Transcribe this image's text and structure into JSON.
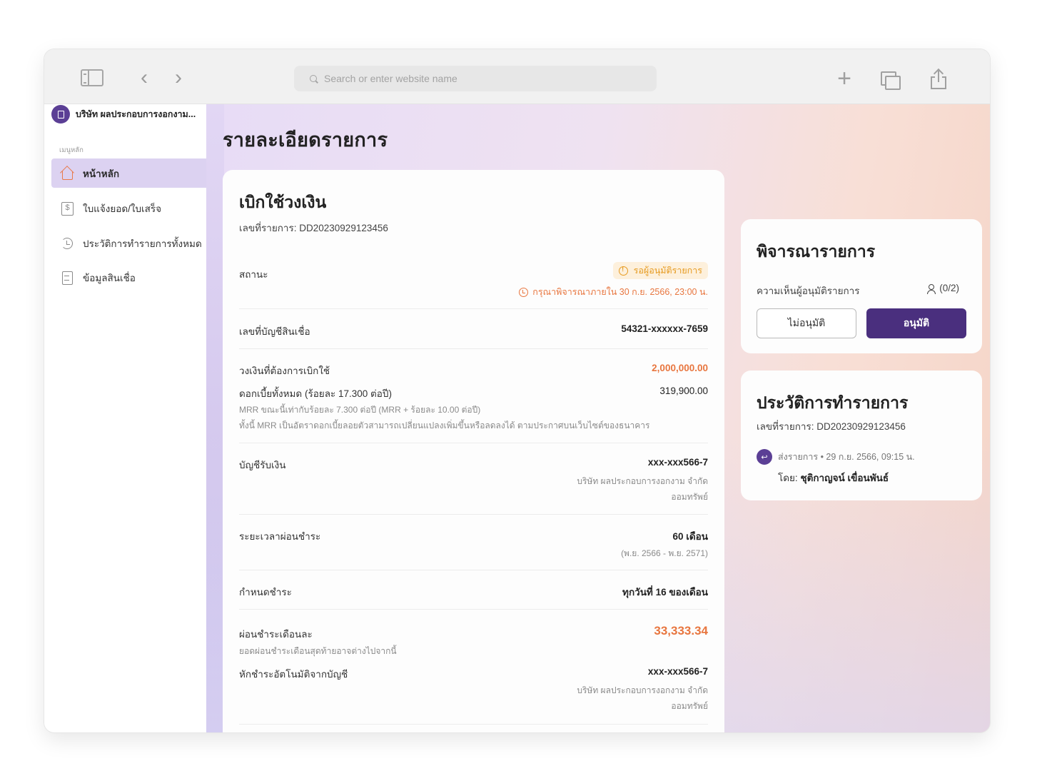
{
  "browser": {
    "search_placeholder": "Search or enter website name"
  },
  "sidebar": {
    "company_name": "บริษัท ผลประกอบการงอกงาม...",
    "menu_caption": "เมนูหลัก",
    "items": [
      {
        "label": "หน้าหลัก",
        "icon": "home-icon",
        "active": true
      },
      {
        "label": "ใบแจ้งยอด/ใบเสร็จ",
        "icon": "bill-icon",
        "active": false
      },
      {
        "label": "ประวัติการทำรายการทั้งหมด",
        "icon": "history-icon",
        "active": false
      },
      {
        "label": "ข้อมูลสินเชื่อ",
        "icon": "document-icon",
        "active": false
      }
    ]
  },
  "page": {
    "title": "รายละเอียดรายการ"
  },
  "detail": {
    "title": "เบิกใช้วงเงิน",
    "reference": "เลขที่รายการ: DD20230929123456",
    "status_label": "สถานะ",
    "status_badge": "รอผู้อนุมัติรายการ",
    "status_deadline": "กรุณาพิจารณาภายใน 30 ก.ย. 2566, 23:00 น.",
    "account_label": "เลขที่บัญชีสินเชื่อ",
    "account_value": "54321-xxxxxx-7659",
    "amount_label": "วงเงินที่ต้องการเบิกใช้",
    "amount_value": "2,000,000.00",
    "interest_label": "ดอกเบี้ยทั้งหมด (ร้อยละ 17.300 ต่อปี)",
    "interest_value": "319,900.00",
    "interest_note_1": "MRR ขณะนี้เท่ากับร้อยละ 7.300 ต่อปี (MRR + ร้อยละ 10.00 ต่อปี)",
    "interest_note_2": "ทั้งนี้ MRR เป็นอัตราดอกเบี้ยลอยตัวสามารถเปลี่ยนแปลงเพิ่มขึ้นหรือลดลงได้ ตามประกาศบนเว็บไซต์ของธนาคาร",
    "receive_label": "บัญชีรับเงิน",
    "receive_account": "xxx-xxx566-7",
    "receive_company": "บริษัท ผลประกอบการงอกงาม จำกัด",
    "receive_type": "ออมทรัพย์",
    "term_label": "ระยะเวลาผ่อนชำระ",
    "term_value": "60 เดือน",
    "term_range": "(พ.ย. 2566 - พ.ย. 2571)",
    "due_label": "กำหนดชำระ",
    "due_value": "ทุกวันที่ 16 ของเดือน",
    "monthly_label": "ผ่อนชำระเดือนละ",
    "monthly_value": "33,333.34",
    "monthly_note": "ยอดผ่อนชำระเดือนสุดท้ายอาจต่างไปจากนี้",
    "autodebit_label": "หักชำระอัตโนมัติจากบัญชี",
    "autodebit_account": "xxx-xxx566-7",
    "autodebit_company": "บริษัท ผลประกอบการงอกงาม จำกัด",
    "autodebit_type": "ออมทรัพย์"
  },
  "review": {
    "title": "พิจารณารายการ",
    "approver_label": "ความเห็นผู้อนุมัติรายการ",
    "approver_count": "(0/2)",
    "reject_label": "ไม่อนุมัติ",
    "approve_label": "อนุมัติ"
  },
  "history": {
    "title": "ประวัติการทำรายการ",
    "reference": "เลขที่รายการ: DD20230929123456",
    "event": "ส่งรายการ",
    "event_time": "• 29 ก.ย. 2566, 09:15 น.",
    "by_prefix": "โดย:",
    "by_name": "ชุติกาญจน์ เขื่อนพันธ์"
  },
  "colors": {
    "brand_purple": "#4a2f7e",
    "accent_orange": "#e8763f",
    "status_amber": "#e69a1f"
  }
}
